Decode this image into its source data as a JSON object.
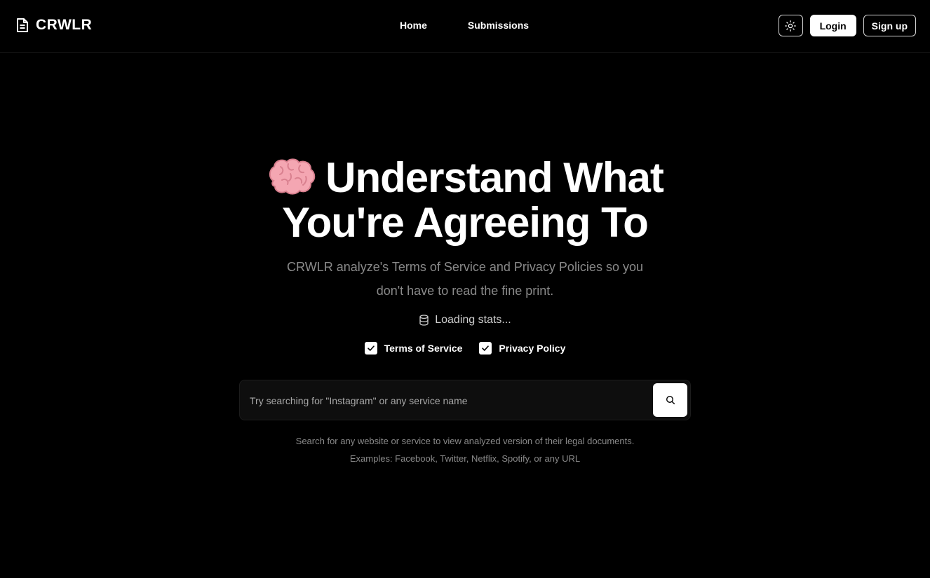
{
  "header": {
    "brand": "CRWLR",
    "nav": {
      "home": "Home",
      "submissions": "Submissions"
    },
    "login": "Login",
    "signup": "Sign up"
  },
  "hero": {
    "title_line1": "Understand What",
    "title_line2": "You're Agreeing To",
    "subtitle_line1": "CRWLR analyze's Terms of Service and Privacy Policies so you",
    "subtitle_line2": "don't have to read the fine print.",
    "stats": "Loading stats..."
  },
  "filters": {
    "tos": {
      "label": "Terms of Service",
      "checked": true
    },
    "privacy": {
      "label": "Privacy Policy",
      "checked": true
    }
  },
  "search": {
    "placeholder": "Try searching for \"Instagram\" or any service name",
    "value": ""
  },
  "help": {
    "line1": "Search for any website or service to view analyzed version of their legal documents.",
    "line2": "Examples: Facebook, Twitter, Netflix, Spotify, or any URL"
  },
  "icons": {
    "brand": "document-icon",
    "theme": "sun-icon",
    "stats": "database-icon",
    "search": "search-icon",
    "hero": "brain-emoji"
  },
  "colors": {
    "background": "#000000",
    "text": "#ffffff",
    "muted": "#8a8a8a"
  }
}
